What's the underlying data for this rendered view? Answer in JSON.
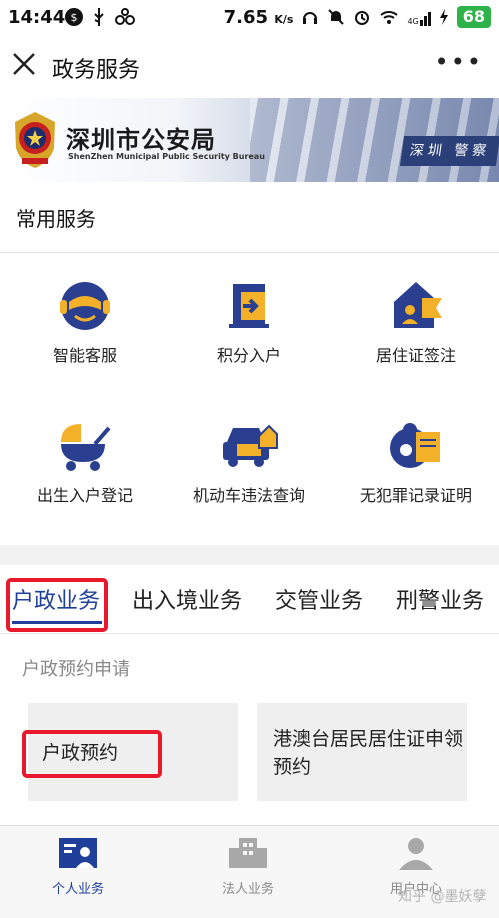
{
  "status_bar": {
    "time": "14:44",
    "net_speed": "7.65",
    "net_unit": "K/s",
    "signal_label": "4G",
    "battery": "68"
  },
  "nav": {
    "title": "政务服务",
    "close_icon": "close-icon",
    "more_icon": "more-icon"
  },
  "banner": {
    "title": "深圳市公安局",
    "subtitle": "ShenZhen Municipal Public Security Bureau",
    "plate_text": "深圳 警察"
  },
  "common_services": {
    "title": "常用服务",
    "items": [
      {
        "label": "智能客服",
        "icon": "customer-service-icon"
      },
      {
        "label": "积分入户",
        "icon": "points-entry-icon"
      },
      {
        "label": "居住证签注",
        "icon": "residence-permit-icon"
      },
      {
        "label": "出生入户登记",
        "icon": "birth-registration-icon"
      },
      {
        "label": "机动车违法查询",
        "icon": "vehicle-violation-icon"
      },
      {
        "label": "无犯罪记录证明",
        "icon": "no-criminal-record-icon"
      }
    ]
  },
  "tabs": {
    "items": [
      {
        "label": "户政业务",
        "active": true
      },
      {
        "label": "出入境业务",
        "active": false
      },
      {
        "label": "交管业务",
        "active": false
      },
      {
        "label": "刑警业务",
        "active": false
      }
    ]
  },
  "section": {
    "title": "户政预约申请",
    "cards": [
      {
        "label": "户政预约"
      },
      {
        "label": "港澳台居民居住证申领预约"
      }
    ]
  },
  "bottom_nav": {
    "items": [
      {
        "label": "个人业务",
        "active": true
      },
      {
        "label": "法人业务",
        "active": false
      },
      {
        "label": "用户中心",
        "active": false
      }
    ]
  },
  "watermark": "知乎 @墨妖孽",
  "colors": {
    "accent": "#1f3f9a",
    "highlight": "#e8192c",
    "icon_yellow": "#f3b12a",
    "icon_blue": "#2a3f8f"
  }
}
